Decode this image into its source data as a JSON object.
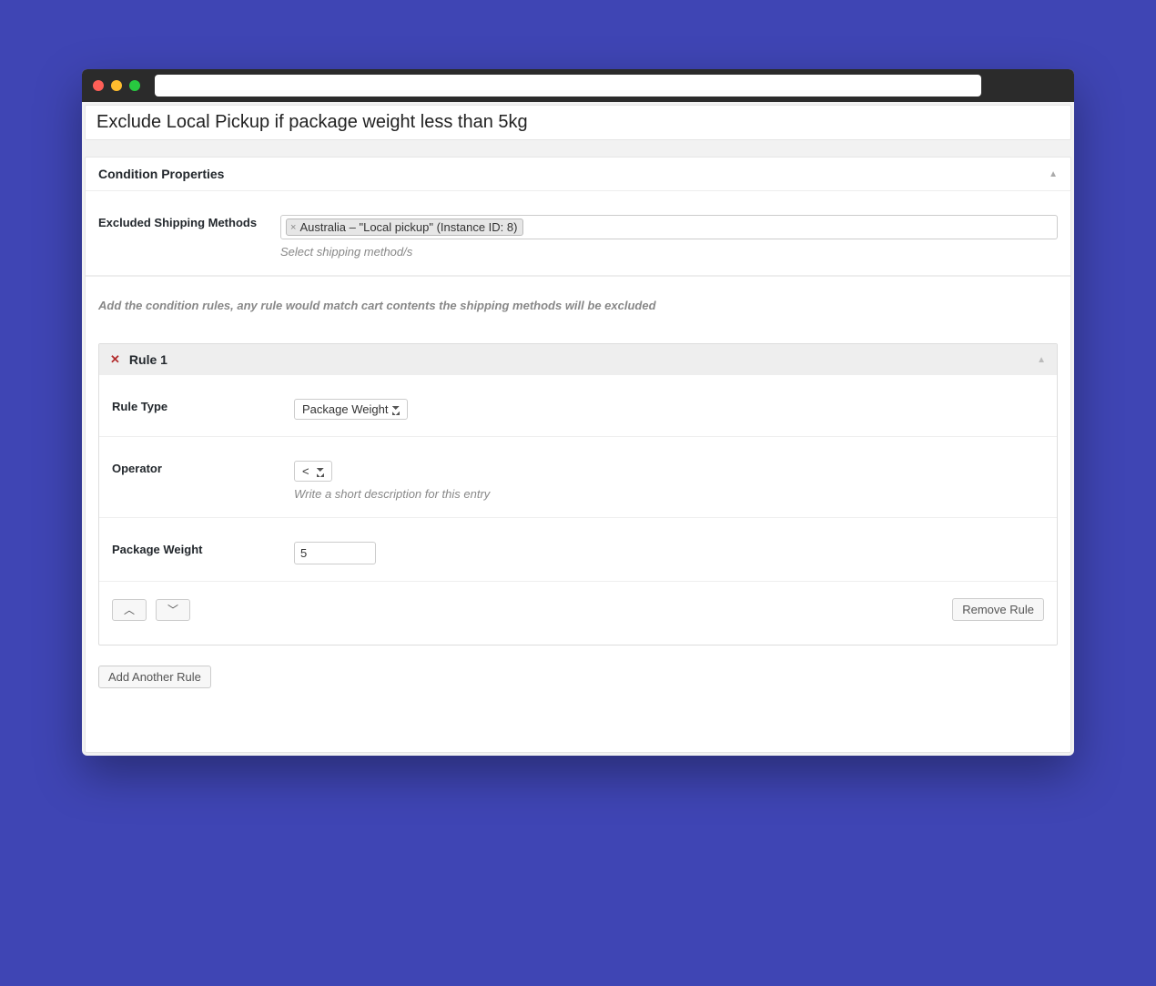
{
  "title": "Exclude Local Pickup if package weight less than 5kg",
  "panel": {
    "header": "Condition Properties",
    "excluded_label": "Excluded Shipping Methods",
    "excluded_tag": "Australia – \"Local pickup\" (Instance ID: 8)",
    "excluded_hint": "Select shipping method/s",
    "info_text": "Add the condition rules, any rule would match cart contents the shipping methods will be excluded"
  },
  "rule": {
    "header": "Rule 1",
    "type_label": "Rule Type",
    "type_value": "Package Weight",
    "operator_label": "Operator",
    "operator_value": "<",
    "operator_hint": "Write a short description for this entry",
    "weight_label": "Package Weight",
    "weight_value": "5",
    "remove_label": "Remove Rule"
  },
  "add_rule_label": "Add Another Rule"
}
